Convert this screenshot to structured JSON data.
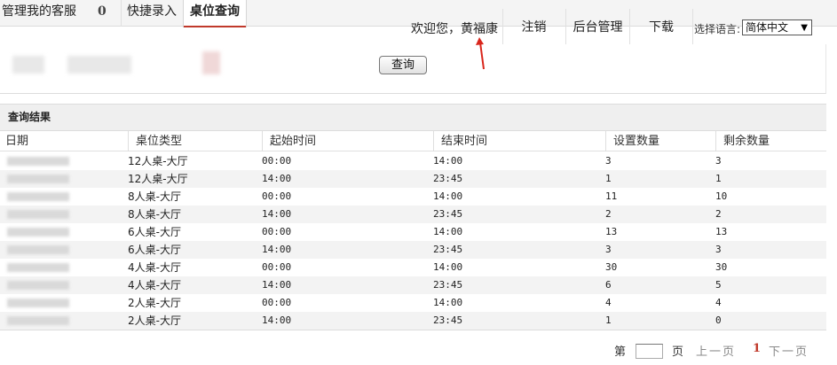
{
  "tabs": {
    "manage_label": "管理我的客服",
    "manage_count": "0",
    "quick_label": "快捷录入",
    "seat_label": "桌位查询"
  },
  "header": {
    "welcome": "欢迎您，黄福康",
    "logout": "注销",
    "admin": "后台管理",
    "download": "下载",
    "lang_label": "选择语言:",
    "lang_value": "简体中文",
    "accent_color": "#c0392b"
  },
  "query": {
    "button_label": "查询"
  },
  "results": {
    "title": "查询结果",
    "columns": [
      "日期",
      "桌位类型",
      "起始时间",
      "结束时间",
      "设置数量",
      "剩余数量"
    ],
    "rows": [
      {
        "type": "12人桌-大厅",
        "start": "00:00",
        "end": "14:00",
        "set": "3",
        "remain": "3"
      },
      {
        "type": "12人桌-大厅",
        "start": "14:00",
        "end": "23:45",
        "set": "1",
        "remain": "1"
      },
      {
        "type": "8人桌-大厅",
        "start": "00:00",
        "end": "14:00",
        "set": "11",
        "remain": "10"
      },
      {
        "type": "8人桌-大厅",
        "start": "14:00",
        "end": "23:45",
        "set": "2",
        "remain": "2"
      },
      {
        "type": "6人桌-大厅",
        "start": "00:00",
        "end": "14:00",
        "set": "13",
        "remain": "13"
      },
      {
        "type": "6人桌-大厅",
        "start": "14:00",
        "end": "23:45",
        "set": "3",
        "remain": "3"
      },
      {
        "type": "4人桌-大厅",
        "start": "00:00",
        "end": "14:00",
        "set": "30",
        "remain": "30"
      },
      {
        "type": "4人桌-大厅",
        "start": "14:00",
        "end": "23:45",
        "set": "6",
        "remain": "5"
      },
      {
        "type": "2人桌-大厅",
        "start": "00:00",
        "end": "14:00",
        "set": "4",
        "remain": "4"
      },
      {
        "type": "2人桌-大厅",
        "start": "14:00",
        "end": "23:45",
        "set": "1",
        "remain": "0"
      }
    ]
  },
  "pager": {
    "page_label": "第",
    "page_unit": "页",
    "prev": "上一页",
    "current": "1",
    "next": "下一页"
  }
}
